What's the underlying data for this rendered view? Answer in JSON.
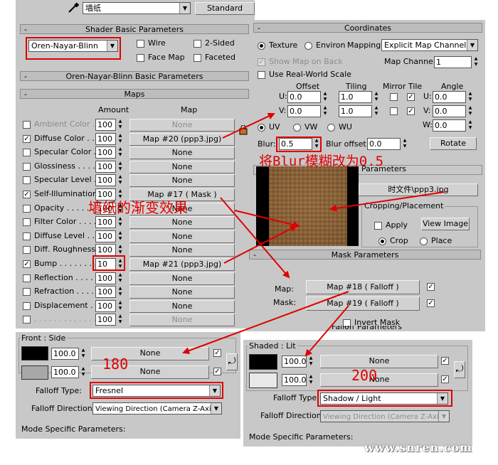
{
  "top": {
    "material_name": "墙纸",
    "type_button": "Standard"
  },
  "shader_basic": {
    "title": "Shader Basic Parameters",
    "shader": "Oren-Nayar-Blinn",
    "wire": "Wire",
    "two_sided": "2-Sided",
    "face_map": "Face Map",
    "faceted": "Faceted"
  },
  "onb_title": "Oren-Nayar-Blinn Basic Parameters",
  "maps": {
    "title": "Maps",
    "amount_header": "Amount",
    "map_header": "Map",
    "rows": [
      {
        "label": "Ambient Color . .",
        "amount": "100",
        "map": "None",
        "checked": false,
        "dim": true
      },
      {
        "label": "Diffuse Color . .",
        "amount": "100",
        "map": "Map #20 (ppp3.jpg)",
        "checked": true,
        "dim": false
      },
      {
        "label": "Specular Color .",
        "amount": "100",
        "map": "None",
        "checked": false,
        "dim": false
      },
      {
        "label": "Glossiness . . . . .",
        "amount": "100",
        "map": "None",
        "checked": false,
        "dim": false
      },
      {
        "label": "Specular Level .",
        "amount": "100",
        "map": "None",
        "checked": false,
        "dim": false
      },
      {
        "label": "Self-Illumination .",
        "amount": "100",
        "map": "Map #17  ( Mask )",
        "checked": true,
        "dim": false
      },
      {
        "label": "Opacity . . . . . . . .",
        "amount": "100",
        "map": "None",
        "checked": false,
        "dim": false
      },
      {
        "label": "Filter Color . . . .",
        "amount": "100",
        "map": "None",
        "checked": false,
        "dim": false
      },
      {
        "label": "Diffuse Level . . .",
        "amount": "100",
        "map": "None",
        "checked": false,
        "dim": false
      },
      {
        "label": "Diff. Roughness .",
        "amount": "100",
        "map": "None",
        "checked": false,
        "dim": false
      },
      {
        "label": "Bump . . . . . . . .",
        "amount": "10",
        "map": "Map #21 (ppp3.jpg)",
        "checked": true,
        "dim": false
      },
      {
        "label": "Reflection . . . . .",
        "amount": "100",
        "map": "None",
        "checked": false,
        "dim": false
      },
      {
        "label": "Refraction . . . . .",
        "amount": "100",
        "map": "None",
        "checked": false,
        "dim": false
      },
      {
        "label": "Displacement . . .",
        "amount": "100",
        "map": "None",
        "checked": false,
        "dim": false
      },
      {
        "label": ". . . . . . . . . . . . . .",
        "amount": "100",
        "map": "None",
        "checked": false,
        "dim": true
      }
    ]
  },
  "coords": {
    "title": "Coordinates",
    "texture": "Texture",
    "environ": "Environ",
    "mapping_label": "Mapping:",
    "mapping_value": "Explicit Map Channel",
    "show_map_on_back": "Show Map on Back",
    "map_channel_label": "Map Channel:",
    "map_channel_value": "1",
    "use_real_world": "Use Real-World Scale",
    "offset": "Offset",
    "tiling": "Tiling",
    "mirror_tile": "Mirror Tile",
    "angle": "Angle",
    "u": "U:",
    "v": "V:",
    "w": "W:",
    "u_offset": "0.0",
    "v_offset": "0.0",
    "u_tiling": "1.0",
    "v_tiling": "1.0",
    "u_angle": "0.0",
    "v_angle": "0.0",
    "w_angle": "0.0",
    "uv": "UV",
    "vw": "VW",
    "wu": "WU",
    "blur_label": "Blur:",
    "blur_value": "0.5",
    "blur_offset_label": "Blur offset:",
    "blur_offset_value": "0.0",
    "rotate": "Rotate"
  },
  "bitmap": {
    "params_title": "Parameters",
    "file_button": "时文件\\ppp3.jpg",
    "cropping": "Cropping/Placement",
    "apply": "Apply",
    "view_image": "View Image",
    "crop": "Crop",
    "place": "Place"
  },
  "mask": {
    "title": "Mask Parameters",
    "map_label": "Map:",
    "map_button": "Map #18  ( Falloff )",
    "mask_label": "Mask:",
    "mask_button": "Map #19  ( Falloff )",
    "invert": "Invert Mask",
    "partial": "Falloff Parameters"
  },
  "falloff_left": {
    "group": "Front : Side",
    "v1": "100.0",
    "v2": "100.0",
    "none1": "None",
    "none2": "None",
    "type_label": "Falloff Type:",
    "type_value": "Fresnel",
    "dir_label": "Falloff Direction:",
    "dir_value": "Viewing Direction (Camera Z-Axis)",
    "mode": "Mode Specific Parameters:",
    "color1": "#000000",
    "color2": "#a8a8a8"
  },
  "falloff_right": {
    "group": "Shaded : Lit",
    "v1": "100.0",
    "v2": "100.0",
    "none1": "None",
    "none2": "None",
    "type_label": "Falloff Type:",
    "type_value": "Shadow / Light",
    "dir_label": "Falloff Direction:",
    "dir_value": "Viewing Direction (Camera Z-Axis)",
    "mode": "Mode Specific Parameters:",
    "color1": "#000000",
    "color2": "#e8e8e8"
  },
  "annotations": {
    "blur_note": "将Blur模糊改为0.5",
    "wallpaper_note": "墙纸的渐变效果",
    "num_180": "180",
    "num_200": "200",
    "watermark": "www.snren.com"
  },
  "colors": {
    "panel_bg": "#c8c8c8",
    "annotation_red": "#e00000"
  }
}
